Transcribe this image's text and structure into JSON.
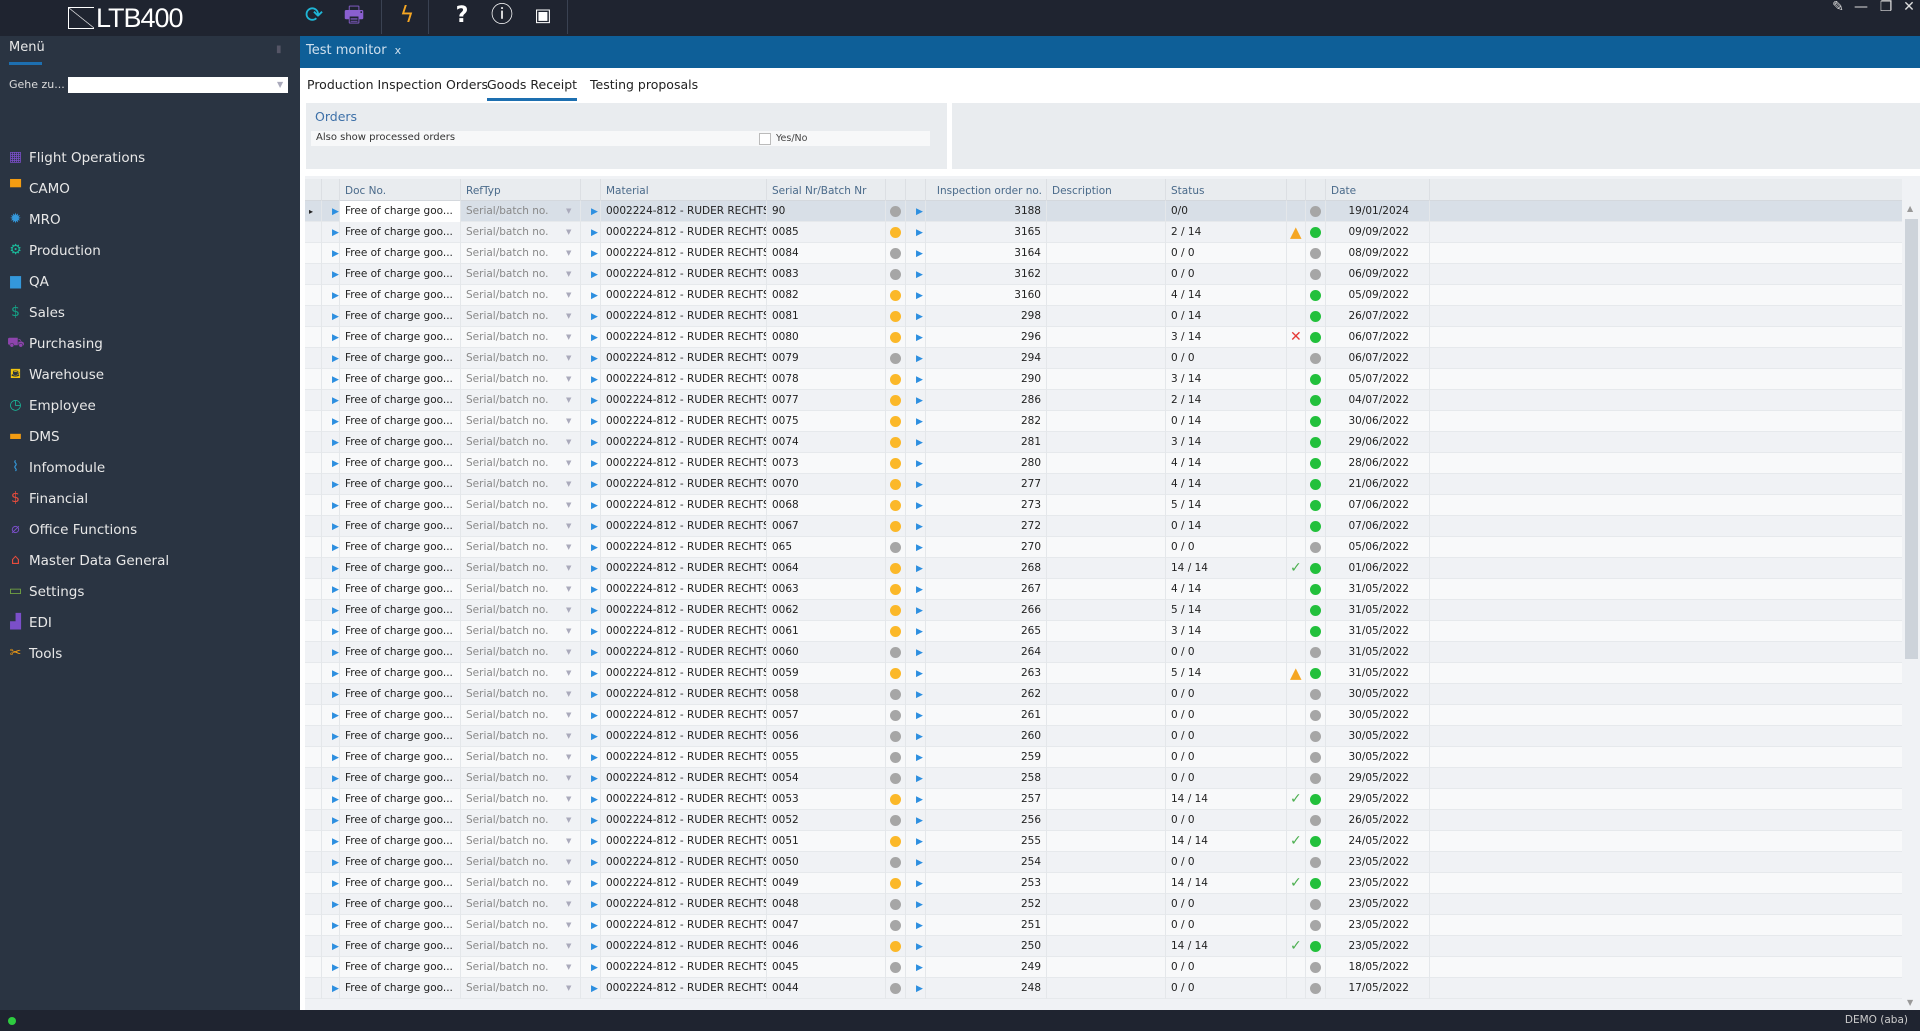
{
  "app": {
    "logo": "LTB400"
  },
  "toolbar": {
    "icons": [
      "refresh-icon",
      "print-icon",
      "lightning-icon",
      "help-icon",
      "info-icon",
      "image-icon"
    ]
  },
  "menu": {
    "title": "Menü",
    "goto_label": "Gehe zu...",
    "goto_value": "",
    "items": [
      {
        "label": "Flight Operations",
        "icon": "calendar-icon",
        "color": "#7b4fc9"
      },
      {
        "label": "CAMO",
        "icon": "camo-icon",
        "color": "#f39c12"
      },
      {
        "label": "MRO",
        "icon": "gear-icon",
        "color": "#3498db"
      },
      {
        "label": "Production",
        "icon": "gears-icon",
        "color": "#1abc9c"
      },
      {
        "label": "QA",
        "icon": "folder-doc-icon",
        "color": "#3498db"
      },
      {
        "label": "Sales",
        "icon": "dollar-circle-icon",
        "color": "#16a085"
      },
      {
        "label": "Purchasing",
        "icon": "cart-icon",
        "color": "#8e44ad"
      },
      {
        "label": "Warehouse",
        "icon": "hand-truck-icon",
        "color": "#f1c40f"
      },
      {
        "label": "Employee",
        "icon": "clock-icon",
        "color": "#1abc9c"
      },
      {
        "label": "DMS",
        "icon": "folder-icon",
        "color": "#f39c12"
      },
      {
        "label": "Infomodule",
        "icon": "chart-icon",
        "color": "#3498db"
      },
      {
        "label": "Financial",
        "icon": "money-icon",
        "color": "#e74c3c"
      },
      {
        "label": "Office Functions",
        "icon": "paperclip-icon",
        "color": "#7b4fc9"
      },
      {
        "label": "Master Data General",
        "icon": "home-icon",
        "color": "#e74c3c"
      },
      {
        "label": "Settings",
        "icon": "monitor-icon",
        "color": "#7cb342"
      },
      {
        "label": "EDI",
        "icon": "factory-icon",
        "color": "#7b4fc9"
      },
      {
        "label": "Tools",
        "icon": "tools-icon",
        "color": "#f39c12"
      }
    ]
  },
  "tab": {
    "label": "Test monitor",
    "close": "x"
  },
  "subtabs": [
    {
      "label": "Production Inspection Orders"
    },
    {
      "label": "Goods Receipt",
      "active": true
    },
    {
      "label": "Testing proposals"
    }
  ],
  "orders": {
    "title": "Orders",
    "filter_label": "Also show processed orders",
    "filter_checked": false,
    "filter_value": "Yes/No"
  },
  "grid": {
    "columns": [
      "Doc No.",
      "RefTyp",
      "Material",
      "Serial Nr/Batch Nr",
      "Inspection order no.",
      "Description",
      "Status",
      "Date"
    ],
    "doc_no": "Free of charge goo...",
    "ref_typ": "Serial/batch no.",
    "material": "0002224-812 - RUDER RECHTS",
    "colors": {
      "grey": "#a6a6a6",
      "orange": "#fbb829",
      "green": "#22c03c",
      "warn": "#f5a623",
      "cross": "#e53935",
      "check": "#4caf50"
    },
    "rows": [
      [
        "90",
        "3188",
        "0/0",
        "",
        "grey",
        "grey",
        "19/01/2024"
      ],
      [
        "0085",
        "3165",
        "2 / 14",
        "warn",
        "orange",
        "green",
        "09/09/2022"
      ],
      [
        "0084",
        "3164",
        "0 / 0",
        "",
        "grey",
        "grey",
        "08/09/2022"
      ],
      [
        "0083",
        "3162",
        "0 / 0",
        "",
        "grey",
        "grey",
        "06/09/2022"
      ],
      [
        "0082",
        "3160",
        "4 / 14",
        "",
        "orange",
        "green",
        "05/09/2022"
      ],
      [
        "0081",
        "298",
        "0 / 14",
        "",
        "orange",
        "green",
        "26/07/2022"
      ],
      [
        "0080",
        "296",
        "3 / 14",
        "cross",
        "orange",
        "green",
        "06/07/2022"
      ],
      [
        "0079",
        "294",
        "0 / 0",
        "",
        "grey",
        "grey",
        "06/07/2022"
      ],
      [
        "0078",
        "290",
        "3 / 14",
        "",
        "orange",
        "green",
        "05/07/2022"
      ],
      [
        "0077",
        "286",
        "2 / 14",
        "",
        "orange",
        "green",
        "04/07/2022"
      ],
      [
        "0075",
        "282",
        "0 / 14",
        "",
        "orange",
        "green",
        "30/06/2022"
      ],
      [
        "0074",
        "281",
        "3 / 14",
        "",
        "orange",
        "green",
        "29/06/2022"
      ],
      [
        "0073",
        "280",
        "4 / 14",
        "",
        "orange",
        "green",
        "28/06/2022"
      ],
      [
        "0070",
        "277",
        "4 / 14",
        "",
        "orange",
        "green",
        "21/06/2022"
      ],
      [
        "0068",
        "273",
        "5 / 14",
        "",
        "orange",
        "green",
        "07/06/2022"
      ],
      [
        "0067",
        "272",
        "0 / 14",
        "",
        "orange",
        "green",
        "07/06/2022"
      ],
      [
        "065",
        "270",
        "0 / 0",
        "",
        "grey",
        "grey",
        "05/06/2022"
      ],
      [
        "0064",
        "268",
        "14 / 14",
        "check",
        "orange",
        "green",
        "01/06/2022"
      ],
      [
        "0063",
        "267",
        "4 / 14",
        "",
        "orange",
        "green",
        "31/05/2022"
      ],
      [
        "0062",
        "266",
        "5 / 14",
        "",
        "orange",
        "green",
        "31/05/2022"
      ],
      [
        "0061",
        "265",
        "3 / 14",
        "",
        "orange",
        "green",
        "31/05/2022"
      ],
      [
        "0060",
        "264",
        "0 / 0",
        "",
        "grey",
        "grey",
        "31/05/2022"
      ],
      [
        "0059",
        "263",
        "5 / 14",
        "warn",
        "orange",
        "green",
        "31/05/2022"
      ],
      [
        "0058",
        "262",
        "0 / 0",
        "",
        "grey",
        "grey",
        "30/05/2022"
      ],
      [
        "0057",
        "261",
        "0 / 0",
        "",
        "grey",
        "grey",
        "30/05/2022"
      ],
      [
        "0056",
        "260",
        "0 / 0",
        "",
        "grey",
        "grey",
        "30/05/2022"
      ],
      [
        "0055",
        "259",
        "0 / 0",
        "",
        "grey",
        "grey",
        "30/05/2022"
      ],
      [
        "0054",
        "258",
        "0 / 0",
        "",
        "grey",
        "grey",
        "29/05/2022"
      ],
      [
        "0053",
        "257",
        "14 / 14",
        "check",
        "orange",
        "green",
        "29/05/2022"
      ],
      [
        "0052",
        "256",
        "0 / 0",
        "",
        "grey",
        "grey",
        "26/05/2022"
      ],
      [
        "0051",
        "255",
        "14 / 14",
        "check",
        "orange",
        "green",
        "24/05/2022"
      ],
      [
        "0050",
        "254",
        "0 / 0",
        "",
        "grey",
        "grey",
        "23/05/2022"
      ],
      [
        "0049",
        "253",
        "14 / 14",
        "check",
        "orange",
        "green",
        "23/05/2022"
      ],
      [
        "0048",
        "252",
        "0 / 0",
        "",
        "grey",
        "grey",
        "23/05/2022"
      ],
      [
        "0047",
        "251",
        "0 / 0",
        "",
        "grey",
        "grey",
        "23/05/2022"
      ],
      [
        "0046",
        "250",
        "14 / 14",
        "check",
        "orange",
        "green",
        "23/05/2022"
      ],
      [
        "0045",
        "249",
        "0 / 0",
        "",
        "grey",
        "grey",
        "18/05/2022"
      ],
      [
        "0044",
        "248",
        "0 / 0",
        "",
        "grey",
        "grey",
        "17/05/2022"
      ]
    ]
  },
  "statusbar": {
    "user": "DEMO (aba)"
  }
}
